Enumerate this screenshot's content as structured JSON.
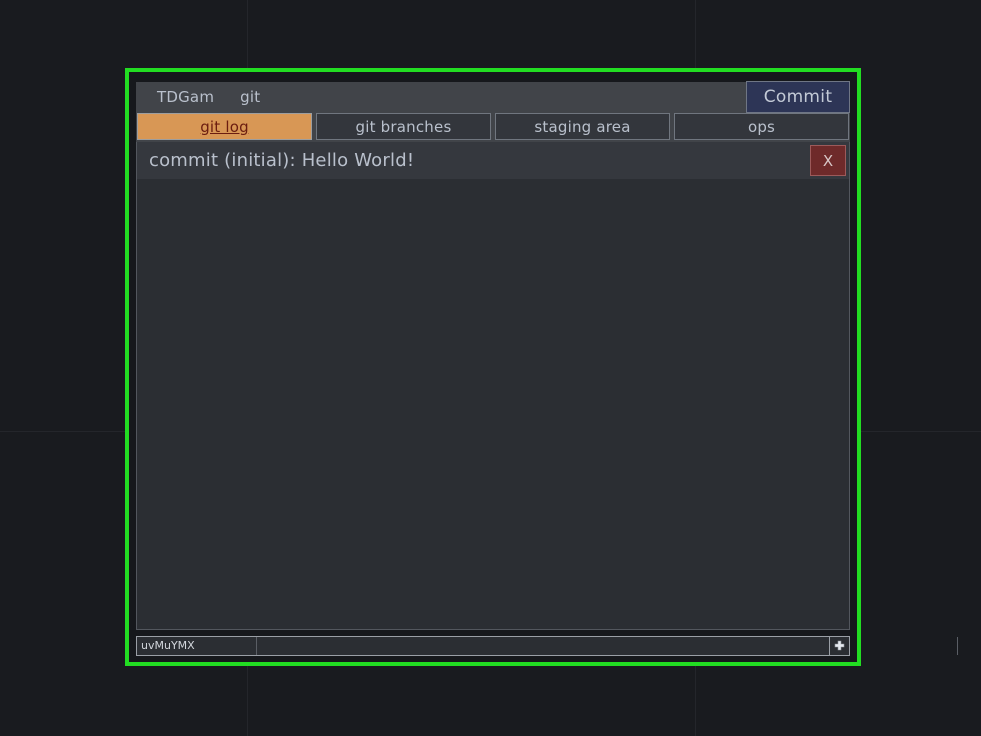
{
  "window": {
    "accent_border_color": "#22dd22",
    "panel_bg_color": "#2b2e33"
  },
  "menu": {
    "items": [
      {
        "label": "TDGam",
        "name": "menu-item-tdgam"
      },
      {
        "label": "git",
        "name": "menu-item-git"
      }
    ],
    "commit_label": "Commit"
  },
  "tabs": [
    {
      "label": "git log",
      "active": true
    },
    {
      "label": "git branches",
      "active": false
    },
    {
      "label": "staging area",
      "active": false
    },
    {
      "label": "ops",
      "active": false
    }
  ],
  "log": {
    "entries": [
      {
        "text": "commit (initial): Hello World!",
        "delete_label": "X"
      }
    ]
  },
  "command_bar": {
    "value": "uvMuYMX",
    "placeholder": "",
    "add_label": "+"
  }
}
